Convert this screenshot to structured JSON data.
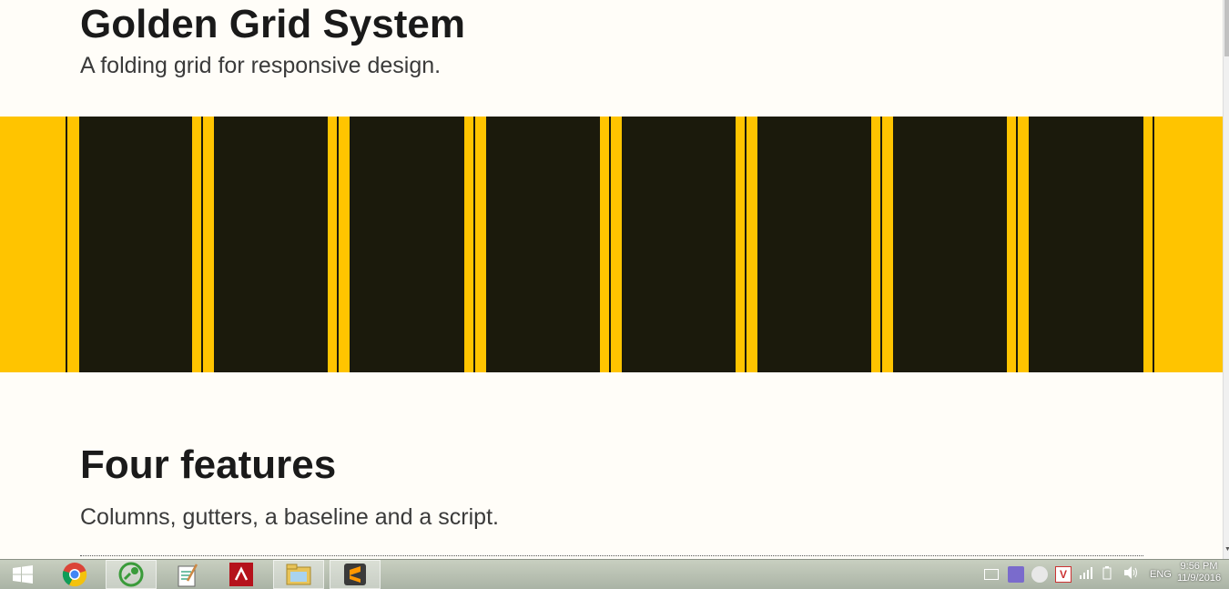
{
  "header": {
    "title": "Golden Grid System",
    "subtitle": "A folding grid for responsive design."
  },
  "grid_demo": {
    "colors": {
      "background": "#fffdf8",
      "band": "#ffc400",
      "column": "#1b1a0c"
    },
    "column_count": 8
  },
  "section": {
    "heading": "Four features",
    "text": "Columns, gutters, a baseline and a script."
  },
  "taskbar": {
    "items": [
      {
        "name": "windows-start-icon"
      },
      {
        "name": "chrome-icon"
      },
      {
        "name": "app-icon"
      },
      {
        "name": "notepad-icon"
      },
      {
        "name": "filezilla-icon"
      },
      {
        "name": "explorer-icon"
      },
      {
        "name": "sublime-text-icon"
      }
    ],
    "language": "ENG",
    "time": "9:56 PM",
    "date": "11/9/2016"
  }
}
